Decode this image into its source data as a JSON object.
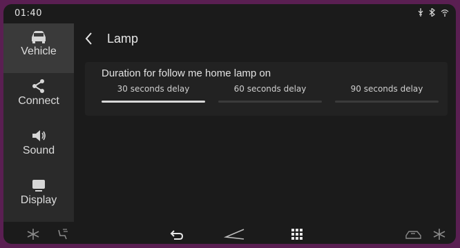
{
  "status": {
    "time": "01:40"
  },
  "sidebar": {
    "items": [
      {
        "label": "Vehicle",
        "icon": "car-icon",
        "active": true
      },
      {
        "label": "Connect",
        "icon": "share-icon",
        "active": false
      },
      {
        "label": "Sound",
        "icon": "speaker-icon",
        "active": false
      },
      {
        "label": "Display",
        "icon": "display-icon",
        "active": false
      }
    ]
  },
  "header": {
    "title": "Lamp"
  },
  "follow_me_home": {
    "label": "Duration for follow me home lamp on",
    "options": [
      {
        "label": "30 seconds delay",
        "selected": true
      },
      {
        "label": "60 seconds delay",
        "selected": false
      },
      {
        "label": "90 seconds delay",
        "selected": false
      }
    ]
  },
  "colors": {
    "background": "#1b1b1b",
    "sidebar": "#2a2a2a",
    "frame": "#5a1f52",
    "selected_bar": "#d9d9d9"
  }
}
